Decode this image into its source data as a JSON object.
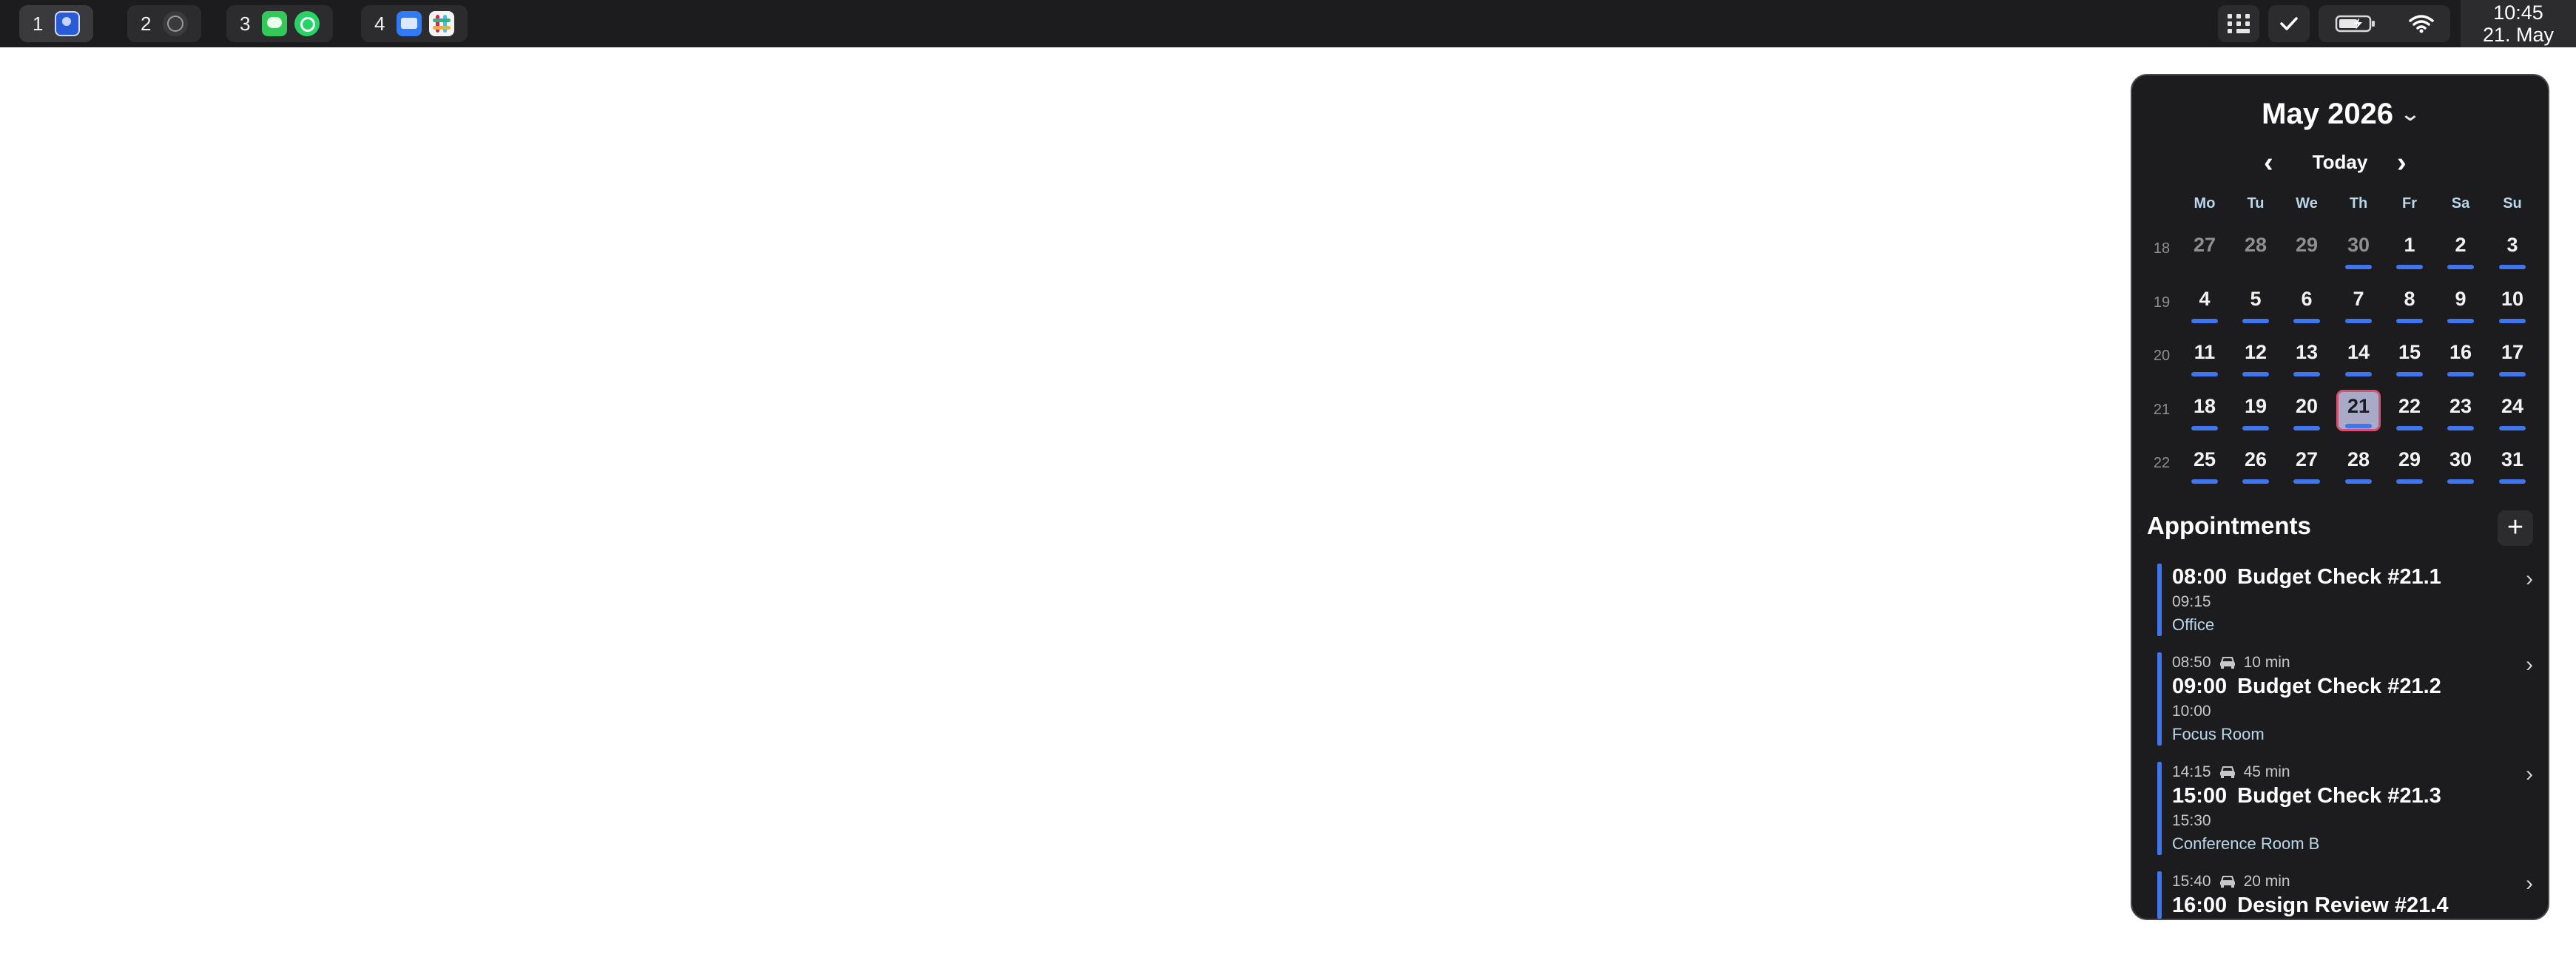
{
  "workspaces": [
    {
      "number": "1",
      "apps": [
        "finder-icon"
      ]
    },
    {
      "number": "2",
      "apps": [
        "circle-app-icon"
      ]
    },
    {
      "number": "3",
      "apps": [
        "messages-icon",
        "whatsapp-icon"
      ]
    },
    {
      "number": "4",
      "apps": [
        "mail-icon",
        "slack-icon"
      ]
    }
  ],
  "statusbar": {
    "icons": [
      "control-grid-icon",
      "checkmark-icon",
      "battery-icon",
      "wifi-icon"
    ],
    "time": "10:45",
    "date": "21. May"
  },
  "calendar": {
    "month_label": "May 2026",
    "today_label": "Today",
    "prev_label": "‹",
    "next_label": "›",
    "weekdays": [
      "Mo",
      "Tu",
      "We",
      "Th",
      "Fr",
      "Sa",
      "Su"
    ],
    "weeks": [
      {
        "number": "18",
        "days": [
          "27",
          "28",
          "29",
          "30",
          "1",
          "2",
          "3"
        ]
      },
      {
        "number": "19",
        "days": [
          "4",
          "5",
          "6",
          "7",
          "8",
          "9",
          "10"
        ]
      },
      {
        "number": "20",
        "days": [
          "11",
          "12",
          "13",
          "14",
          "15",
          "16",
          "17"
        ]
      },
      {
        "number": "21",
        "days": [
          "18",
          "19",
          "20",
          "21",
          "22",
          "23",
          "24"
        ]
      },
      {
        "number": "22",
        "days": [
          "25",
          "26",
          "27",
          "28",
          "29",
          "30",
          "31"
        ]
      }
    ],
    "selected_day": "21",
    "accent_color": "#3f76f0",
    "today_highlight_color": "#a9a9c8",
    "today_border_color": "#d6516e"
  },
  "appointments": {
    "title": "Appointments",
    "add_label": "+",
    "items": [
      {
        "travel_depart": "",
        "travel_duration": "",
        "start": "08:00",
        "title": "Budget Check #21.1",
        "end": "09:15",
        "location": "Office"
      },
      {
        "travel_depart": "08:50",
        "travel_duration": "10 min",
        "start": "09:00",
        "title": "Budget Check #21.2",
        "end": "10:00",
        "location": "Focus Room"
      },
      {
        "travel_depart": "14:15",
        "travel_duration": "45 min",
        "start": "15:00",
        "title": "Budget Check #21.3",
        "end": "15:30",
        "location": "Conference Room B"
      },
      {
        "travel_depart": "15:40",
        "travel_duration": "20 min",
        "start": "16:00",
        "title": "Design Review #21.4",
        "end": "",
        "location": ""
      }
    ]
  }
}
